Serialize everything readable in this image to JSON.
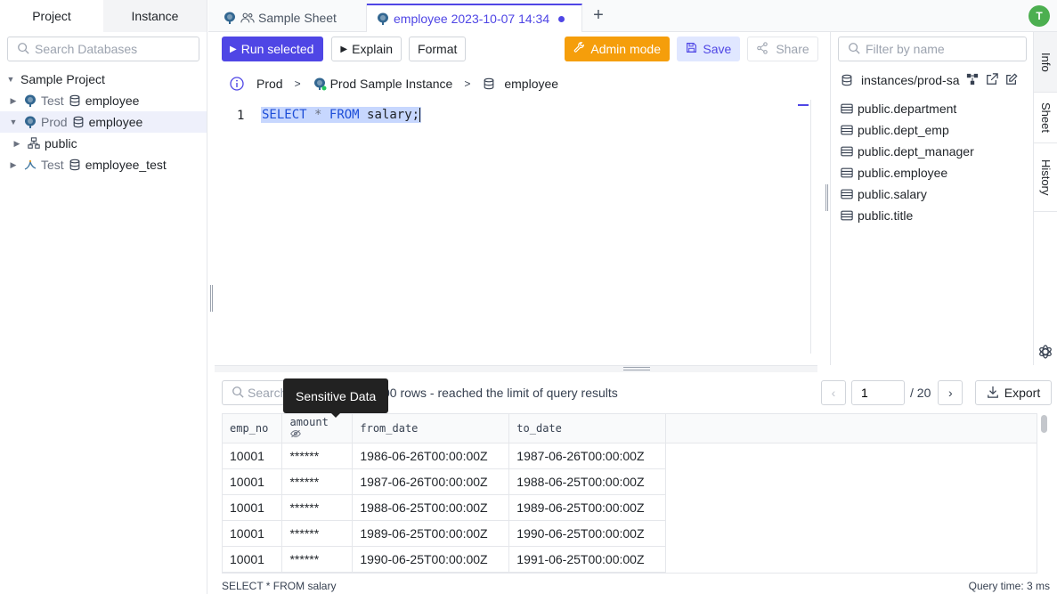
{
  "left_panel": {
    "tabs": [
      "Project",
      "Instance"
    ],
    "search_placeholder": "Search Databases",
    "project_name": "Sample Project",
    "items": [
      {
        "env": "Test",
        "db": "employee"
      },
      {
        "env": "Prod",
        "db": "employee"
      },
      {
        "schema": "public"
      },
      {
        "env": "Test",
        "db": "employee_test"
      }
    ]
  },
  "tabs": {
    "sheet_tab": "Sample Sheet",
    "active_tab": "employee 2023-10-07 14:34",
    "avatar_initial": "T"
  },
  "toolbar": {
    "run": "Run selected",
    "explain": "Explain",
    "format": "Format",
    "admin": "Admin mode",
    "save": "Save",
    "share": "Share"
  },
  "breadcrumb": {
    "env": "Prod",
    "instance": "Prod Sample Instance",
    "database": "employee"
  },
  "editor": {
    "line_number": "1",
    "kw_select": "SELECT",
    "star": "*",
    "kw_from": "FROM",
    "rest": "salary;"
  },
  "info_panel": {
    "filter_placeholder": "Filter by name",
    "instance_path": "instances/prod-sa",
    "tables": [
      "public.department",
      "public.dept_emp",
      "public.dept_manager",
      "public.employee",
      "public.salary",
      "public.title"
    ]
  },
  "side_tabs": [
    "Info",
    "Sheet",
    "History"
  ],
  "results": {
    "search_placeholder": "Search",
    "summary": "00 rows  -  reached the limit of query results",
    "tooltip": "Sensitive Data",
    "page_current": "1",
    "page_total": "/ 20",
    "export": "Export",
    "columns": [
      "emp_no",
      "amount",
      "from_date",
      "to_date"
    ],
    "rows": [
      [
        "10001",
        "******",
        "1986-06-26T00:00:00Z",
        "1987-06-26T00:00:00Z"
      ],
      [
        "10001",
        "******",
        "1987-06-26T00:00:00Z",
        "1988-06-25T00:00:00Z"
      ],
      [
        "10001",
        "******",
        "1988-06-25T00:00:00Z",
        "1989-06-25T00:00:00Z"
      ],
      [
        "10001",
        "******",
        "1989-06-25T00:00:00Z",
        "1990-06-25T00:00:00Z"
      ],
      [
        "10001",
        "******",
        "1990-06-25T00:00:00Z",
        "1991-06-25T00:00:00Z"
      ]
    ]
  },
  "status": {
    "statement": "SELECT * FROM salary",
    "query_time": "Query time: 3 ms"
  },
  "colors": {
    "accent": "#4f46e5",
    "admin": "#f59e0b",
    "avatar": "#4caf50"
  }
}
